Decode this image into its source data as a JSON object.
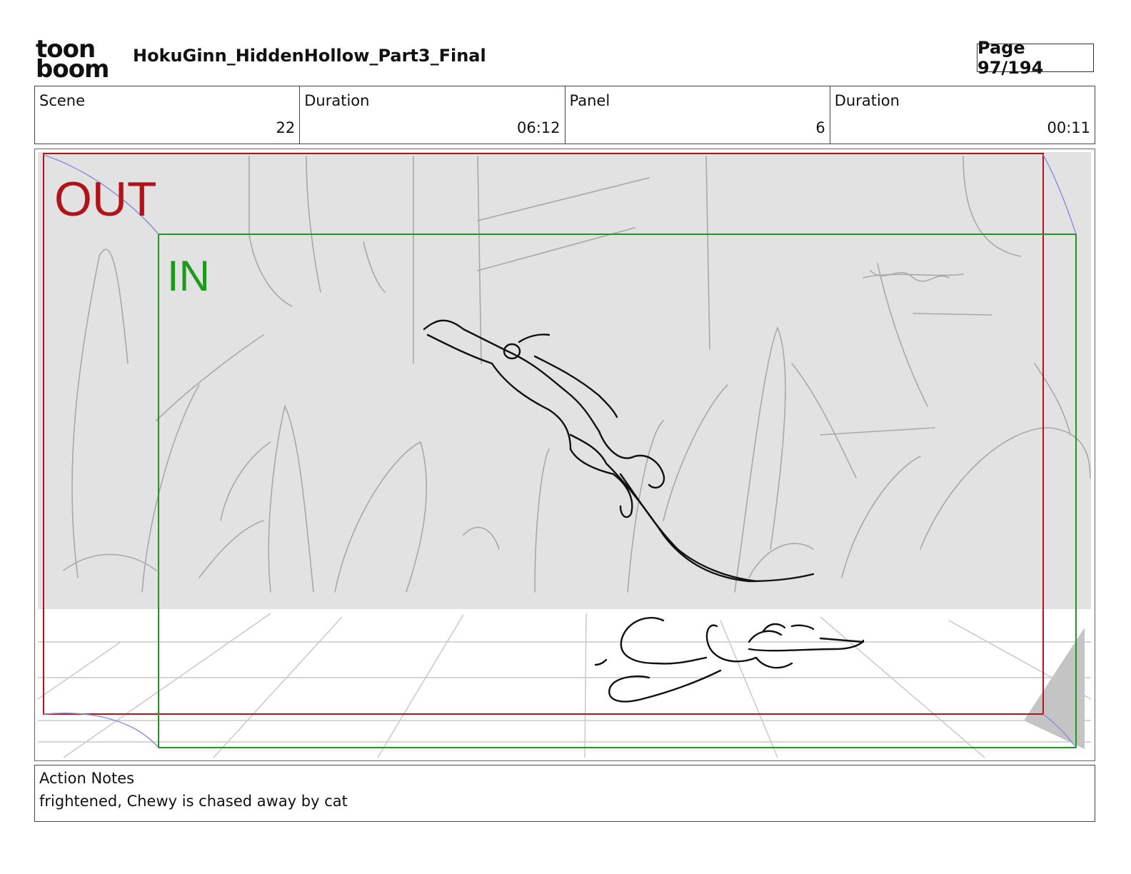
{
  "header": {
    "logo_line1": "toon",
    "logo_line2": "boom",
    "project_title": "HokuGinn_HiddenHollow_Part3_Final",
    "page_label": "Page 97/194"
  },
  "info": {
    "scene_label": "Scene",
    "scene_value": "22",
    "scene_duration_label": "Duration",
    "scene_duration_value": "06:12",
    "panel_label": "Panel",
    "panel_value": "6",
    "panel_duration_label": "Duration",
    "panel_duration_value": "00:11"
  },
  "panel": {
    "out_label": "OUT",
    "in_label": "IN",
    "out_color": "#b0141a",
    "in_color": "#1d9a1d",
    "background_color": "#e2e2e2",
    "floor_color": "#ffffff"
  },
  "notes": {
    "label": "Action Notes",
    "text": "frightened, Chewy is chased away by cat"
  }
}
